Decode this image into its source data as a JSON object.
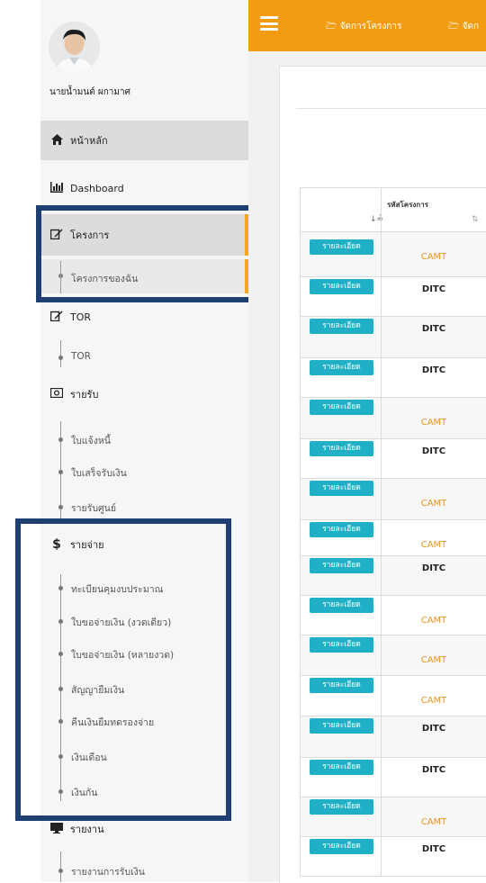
{
  "user": {
    "name": "นายน้ำมนต์ ผกามาศ"
  },
  "topbar": {
    "links": [
      "จัดการโครงการ",
      "จัดก"
    ]
  },
  "sidebar": {
    "home": "หน้าหลัก",
    "dashboard": "Dashboard",
    "project": "โครงการ",
    "project_sub": "โครงการของฉัน",
    "tor": "TOR",
    "tor_sub": "TOR",
    "income": "รายรับ",
    "income_items": [
      "ใบแจ้งหนี้",
      "ใบเสร็จรับเงิน",
      "รายรับศูนย์"
    ],
    "expense": "รายจ่าย",
    "expense_items": [
      "ทะเบียนคุมงบประมาณ",
      "ใบขอจ่ายเงิน (งวดเดียว)",
      "ใบขอจ่ายเงิน (หลายงวด)",
      "สัญญายืมเงิน",
      "คืนเงินยืมทดรองจ่าย",
      "เงินเดือน",
      "เงินกัน"
    ],
    "report": "รายงาน",
    "report_items": [
      "รายงานการรับเงิน"
    ]
  },
  "table": {
    "code_header": "รหัสโครงการ",
    "detail_label": "รายละเอียด",
    "rows": [
      "CAMT",
      "DITC",
      "DITC",
      "DITC",
      "CAMT",
      "DITC",
      "CAMT",
      "CAMT",
      "DITC",
      "CAMT",
      "CAMT",
      "CAMT",
      "DITC",
      "DITC",
      "CAMT",
      "DITC"
    ]
  },
  "colors": {
    "topbar": "#f39c12",
    "highlight_border": "#1f3f73",
    "detail_button": "#1fb0c6",
    "camt_text": "#e89320",
    "active_item": "#dcdcdc",
    "active_accent": "#f5a623"
  }
}
